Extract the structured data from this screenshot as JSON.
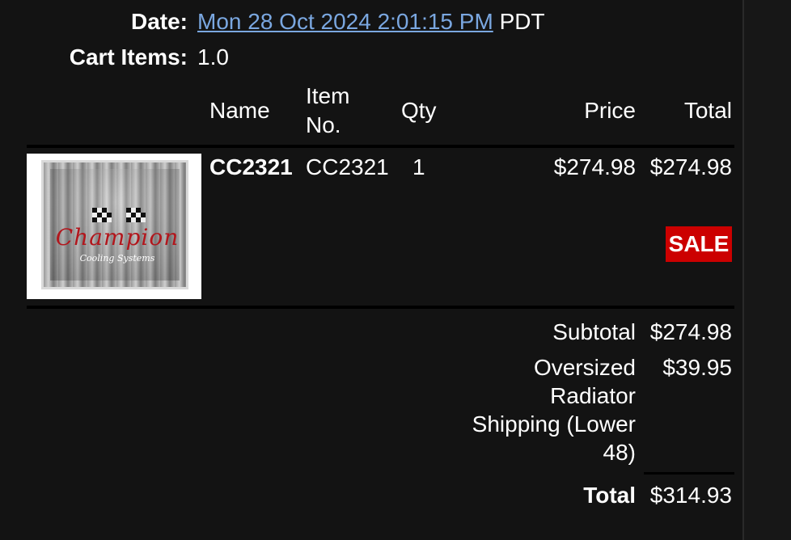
{
  "order": {
    "date_label": "Date:",
    "date_value": "Mon 28 Oct 2024 2:01:15 PM",
    "date_tz": "PDT",
    "cart_items_label": "Cart Items:",
    "cart_items_value": "1.0"
  },
  "table": {
    "headers": {
      "name": "Name",
      "item_no_line1": "Item",
      "item_no_line2": "No.",
      "qty": "Qty",
      "price": "Price",
      "total": "Total"
    },
    "items": [
      {
        "name": "CC2321",
        "item_no": "CC2321",
        "qty": "1",
        "price": "$274.98",
        "total": "$274.98",
        "badge": "SALE",
        "image": {
          "icon": "radiator-product-image",
          "brand_text": "Champion",
          "brand_subtext": "Cooling Systems"
        }
      }
    ]
  },
  "summary": {
    "subtotal_label": "Subtotal",
    "subtotal_value": "$274.98",
    "shipping_label_lines": [
      "Oversized",
      "Radiator",
      "Shipping (Lower",
      "48)"
    ],
    "shipping_value": "$39.95",
    "total_label": "Total",
    "total_value": "$314.93"
  },
  "colors": {
    "background": "#131313",
    "link": "#7aa7e0",
    "sale_badge": "#cc0000",
    "text": "#ffffff"
  }
}
